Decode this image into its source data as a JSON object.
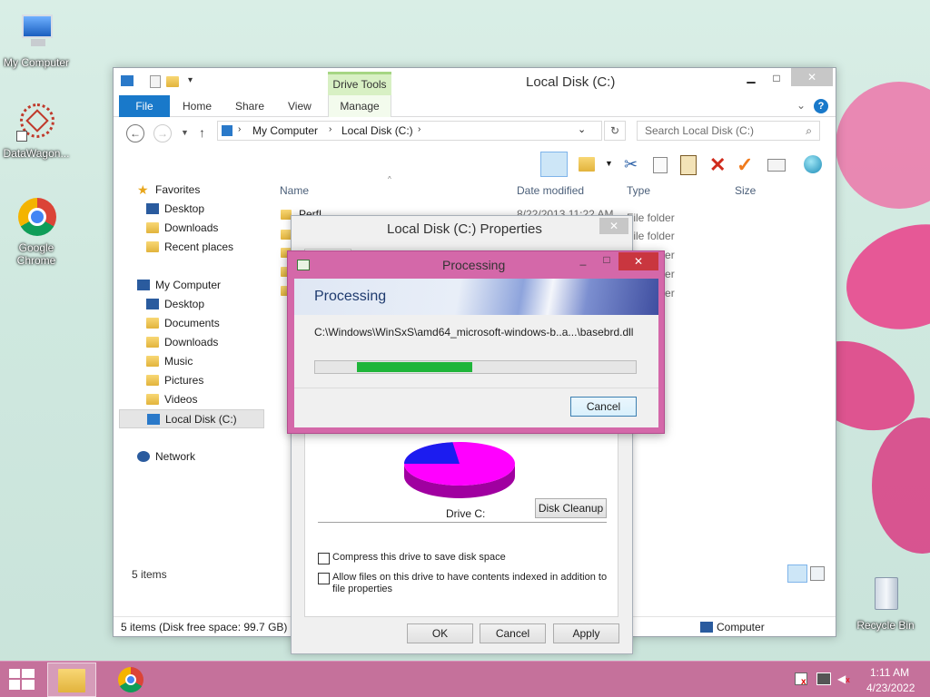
{
  "desktop": {
    "icons": [
      {
        "label": "My Computer"
      },
      {
        "label": "DataWagon..."
      },
      {
        "label": "Google Chrome"
      },
      {
        "label": "Recycle Bin"
      }
    ]
  },
  "explorer": {
    "title": "Local Disk (C:)",
    "contextual_group": "Drive Tools",
    "tabs": [
      "File",
      "Home",
      "Share",
      "View",
      "Manage"
    ],
    "breadcrumb": [
      "My Computer",
      "Local Disk (C:)"
    ],
    "search_placeholder": "Search Local Disk (C:)",
    "nav": {
      "favorites_label": "Favorites",
      "favorites": [
        "Desktop",
        "Downloads",
        "Recent places"
      ],
      "computer_label": "My Computer",
      "computer": [
        "Desktop",
        "Documents",
        "Downloads",
        "Music",
        "Pictures",
        "Videos",
        "Local Disk (C:)"
      ],
      "network_label": "Network"
    },
    "columns": [
      "Name",
      "Date modified",
      "Type",
      "Size"
    ],
    "rows": [
      {
        "name": "PerfL",
        "date": "8/22/2013 11:22 AM",
        "type": "File folder"
      },
      {
        "type": "File folder"
      },
      {
        "type": "File folder"
      },
      {
        "type": "File folder"
      },
      {
        "type": "File folder"
      }
    ],
    "item_count": "5 items",
    "status": "5 items (Disk free space: 99.7 GB)",
    "status_right": "Computer"
  },
  "properties": {
    "title": "Local Disk (C:) Properties",
    "drive_label": "Drive C:",
    "disk_cleanup": "Disk Cleanup",
    "compress": "Compress this drive to save disk space",
    "index": "Allow files on this drive to have contents indexed in addition to file properties",
    "ok": "OK",
    "cancel": "Cancel",
    "apply": "Apply",
    "used_fraction": 0.77,
    "used_color": "#ff00ff",
    "free_color": "#1c1cf0"
  },
  "processing": {
    "title": "Processing",
    "heading": "Processing",
    "path": "C:\\Windows\\WinSxS\\amd64_microsoft-windows-b..a...\\basebrd.dll",
    "progress_start": 0.13,
    "progress_end": 0.49,
    "progress_color": "#1fb53a",
    "cancel": "Cancel"
  },
  "taskbar": {
    "time": "1:11 AM",
    "date": "4/23/2022"
  }
}
